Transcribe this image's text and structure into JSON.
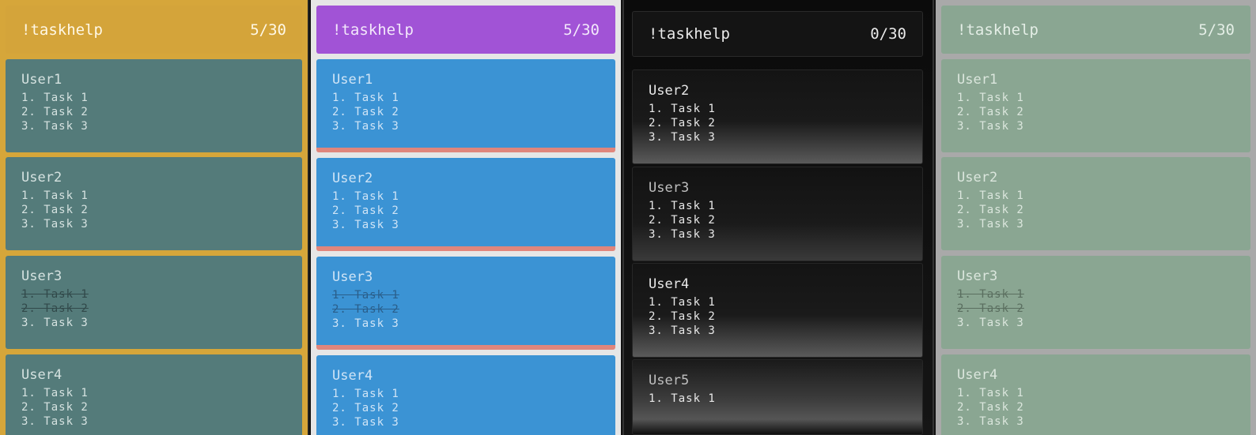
{
  "panels": [
    {
      "header": {
        "command": "!taskhelp",
        "count": "5/30"
      },
      "cards": [
        {
          "user": "User1",
          "tasks": [
            {
              "text": "1. Task 1",
              "done": false
            },
            {
              "text": "2. Task 2",
              "done": false
            },
            {
              "text": "3. Task 3",
              "done": false
            }
          ]
        },
        {
          "user": "User2",
          "tasks": [
            {
              "text": "1. Task 1",
              "done": false
            },
            {
              "text": "2. Task 2",
              "done": false
            },
            {
              "text": "3. Task 3",
              "done": false
            }
          ]
        },
        {
          "user": "User3",
          "tasks": [
            {
              "text": "1. Task 1",
              "done": true
            },
            {
              "text": "2. Task 2",
              "done": true
            },
            {
              "text": "3. Task 3",
              "done": false
            }
          ]
        },
        {
          "user": "User4",
          "tasks": [
            {
              "text": "1. Task 1",
              "done": false
            },
            {
              "text": "2. Task 2",
              "done": false
            },
            {
              "text": "3. Task 3",
              "done": false
            }
          ]
        }
      ]
    },
    {
      "header": {
        "command": "!taskhelp",
        "count": "5/30"
      },
      "cards": [
        {
          "user": "User1",
          "tasks": [
            {
              "text": "1. Task 1",
              "done": false
            },
            {
              "text": "2. Task 2",
              "done": false
            },
            {
              "text": "3. Task 3",
              "done": false
            }
          ]
        },
        {
          "user": "User2",
          "tasks": [
            {
              "text": "1. Task 1",
              "done": false
            },
            {
              "text": "2. Task 2",
              "done": false
            },
            {
              "text": "3. Task 3",
              "done": false
            }
          ]
        },
        {
          "user": "User3",
          "tasks": [
            {
              "text": "1. Task 1",
              "done": true
            },
            {
              "text": "2. Task 2",
              "done": true
            },
            {
              "text": "3. Task 3",
              "done": false
            }
          ]
        },
        {
          "user": "User4",
          "tasks": [
            {
              "text": "1. Task 1",
              "done": false
            },
            {
              "text": "2. Task 2",
              "done": false
            },
            {
              "text": "3. Task 3",
              "done": false
            }
          ]
        }
      ]
    },
    {
      "header": {
        "command": "!taskhelp",
        "count": "0/30"
      },
      "cards": [
        {
          "user": "User2",
          "tasks": [
            {
              "text": "1. Task 1",
              "done": false
            },
            {
              "text": "2. Task 2",
              "done": false
            },
            {
              "text": "3. Task 3",
              "done": false
            }
          ]
        },
        {
          "user": "User3",
          "tasks": [
            {
              "text": "1. Task 1",
              "done": false
            },
            {
              "text": "2. Task 2",
              "done": false
            },
            {
              "text": "3. Task 3",
              "done": false
            }
          ]
        },
        {
          "user": "User4",
          "tasks": [
            {
              "text": "1. Task 1",
              "done": false
            },
            {
              "text": "2. Task 2",
              "done": false
            },
            {
              "text": "3. Task 3",
              "done": false
            }
          ]
        },
        {
          "user": "User5",
          "tasks": [
            {
              "text": "1. Task 1",
              "done": false
            }
          ]
        }
      ]
    },
    {
      "header": {
        "command": "!taskhelp",
        "count": "5/30"
      },
      "cards": [
        {
          "user": "User1",
          "tasks": [
            {
              "text": "1. Task 1",
              "done": false
            },
            {
              "text": "2. Task 2",
              "done": false
            },
            {
              "text": "3. Task 3",
              "done": false
            }
          ]
        },
        {
          "user": "User2",
          "tasks": [
            {
              "text": "1. Task 1",
              "done": false
            },
            {
              "text": "2. Task 2",
              "done": false
            },
            {
              "text": "3. Task 3",
              "done": false
            }
          ]
        },
        {
          "user": "User3",
          "tasks": [
            {
              "text": "1. Task 1",
              "done": true
            },
            {
              "text": "2. Task 2",
              "done": true
            },
            {
              "text": "3. Task 3",
              "done": false
            }
          ]
        },
        {
          "user": "User4",
          "tasks": [
            {
              "text": "1. Task 1",
              "done": false
            },
            {
              "text": "2. Task 2",
              "done": false
            },
            {
              "text": "3. Task 3",
              "done": false
            }
          ]
        }
      ]
    }
  ]
}
